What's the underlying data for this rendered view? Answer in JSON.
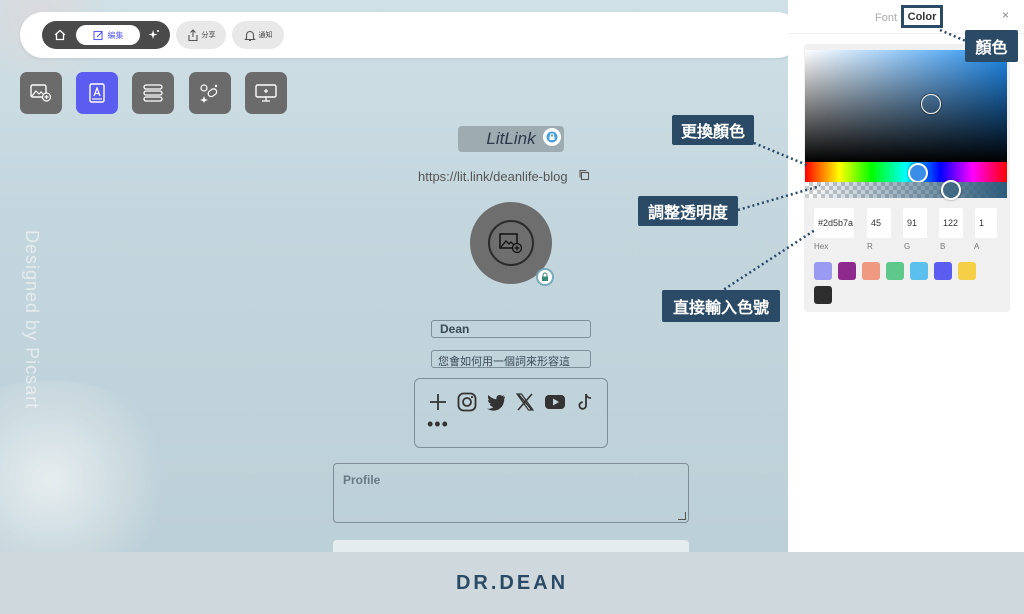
{
  "watermark": "Designed by Picsart",
  "topbar": {
    "edit_label": "編集",
    "share_label": "分享",
    "notify_label": "通知"
  },
  "editor": {
    "logo_text": "LitLink",
    "url": "https://lit.link/deanlife-blog",
    "name": "Dean",
    "description": "您會如何用一個詞來形容這",
    "more": "•••",
    "profile_placeholder": "Profile"
  },
  "panel": {
    "tab_font": "Font",
    "tab_color": "Color",
    "close": "×",
    "hex_value": "#2d5b7a",
    "r_value": "45",
    "g_value": "91",
    "b_value": "122",
    "a_value": "1",
    "hex_label": "Hex",
    "r_label": "R",
    "g_label": "G",
    "b_label": "B",
    "a_label": "A",
    "swatches": [
      "#9a9af2",
      "#8e2a8e",
      "#ef9a80",
      "#5ec78a",
      "#5cc0ee",
      "#5b5cf0",
      "#f5cf45",
      "#2e2e2e"
    ]
  },
  "callouts": {
    "color": "顏色",
    "hue": "更換顏色",
    "alpha": "調整透明度",
    "hex": "直接輸入色號"
  },
  "footer": {
    "brand": "DR.DEAN"
  },
  "colors": {
    "accent": "#5b5cf0",
    "callout": "#2a4a66",
    "current": "#2d5b7a"
  }
}
